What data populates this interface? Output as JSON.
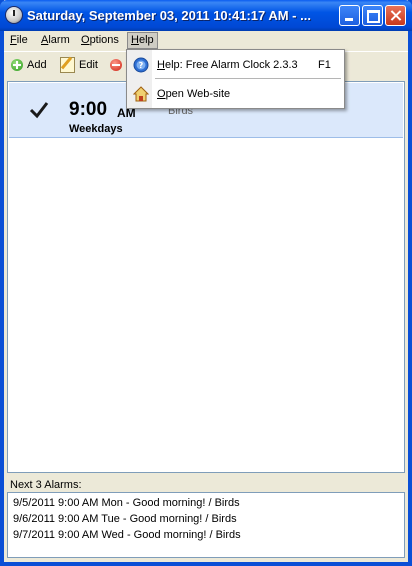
{
  "window": {
    "title": "Saturday, September 03, 2011 10:41:17 AM - ...",
    "controls": [
      "minimize-icon",
      "maximize-icon",
      "close-icon"
    ]
  },
  "menubar": {
    "items": [
      {
        "label": "File",
        "mnemonic": "F",
        "rest": "ile"
      },
      {
        "label": "Alarm",
        "mnemonic": "A",
        "rest": "larm"
      },
      {
        "label": "Options",
        "mnemonic": "O",
        "rest": "ptions"
      },
      {
        "label": "Help",
        "mnemonic": "H",
        "rest": "elp"
      }
    ],
    "active": "Help"
  },
  "toolbar": {
    "add_label": "Add",
    "edit_label": "Edit"
  },
  "alarm": {
    "enabled": true,
    "time": "9:00",
    "ampm": "AM",
    "days": "Weekdays",
    "sound": "Birds"
  },
  "next_alarms": {
    "label": "Next 3 Alarms:",
    "items": [
      "9/5/2011 9:00 AM Mon - Good morning! / Birds",
      "9/6/2011 9:00 AM Tue - Good morning! / Birds",
      "9/7/2011 9:00 AM Wed - Good morning! / Birds"
    ]
  },
  "help_menu": {
    "items": [
      {
        "label_mnemonic": "H",
        "label_rest": "elp: Free Alarm Clock 2.3.3",
        "shortcut": "F1",
        "icon": "help-icon"
      },
      {
        "label_mnemonic": "O",
        "label_rest": "pen Web-site",
        "icon": "home-icon"
      }
    ]
  },
  "colors": {
    "titlebar": "#0055e5",
    "selection": "#dbe8fb",
    "frame": "#ece9d8"
  }
}
